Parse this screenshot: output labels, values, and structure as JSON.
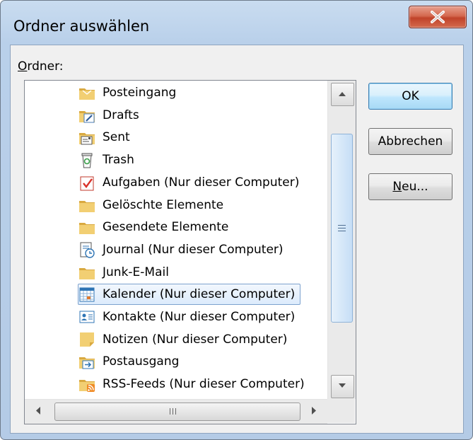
{
  "dialog": {
    "title": "Ordner auswählen",
    "close_label": "X"
  },
  "folder_label": {
    "accel": "O",
    "rest": "rdner:"
  },
  "folders": [
    {
      "label": "Posteingang",
      "icon": "inbox-folder-icon",
      "selected": false
    },
    {
      "label": "Drafts",
      "icon": "drafts-folder-icon",
      "selected": false
    },
    {
      "label": "Sent",
      "icon": "sent-folder-icon",
      "selected": false
    },
    {
      "label": "Trash",
      "icon": "trash-icon",
      "selected": false
    },
    {
      "label": "Aufgaben (Nur dieser Computer)",
      "icon": "tasks-icon",
      "selected": false
    },
    {
      "label": "Gelöschte Elemente",
      "icon": "folder-icon",
      "selected": false
    },
    {
      "label": "Gesendete Elemente",
      "icon": "folder-icon",
      "selected": false
    },
    {
      "label": "Journal (Nur dieser Computer)",
      "icon": "journal-icon",
      "selected": false
    },
    {
      "label": "Junk-E-Mail",
      "icon": "folder-icon",
      "selected": false
    },
    {
      "label": "Kalender (Nur dieser Computer)",
      "icon": "calendar-icon",
      "selected": true
    },
    {
      "label": "Kontakte (Nur dieser Computer)",
      "icon": "contacts-icon",
      "selected": false
    },
    {
      "label": "Notizen (Nur dieser Computer)",
      "icon": "notes-icon",
      "selected": false
    },
    {
      "label": "Postausgang",
      "icon": "outbox-folder-icon",
      "selected": false
    },
    {
      "label": "RSS-Feeds (Nur dieser Computer)",
      "icon": "rss-folder-icon",
      "selected": false
    }
  ],
  "buttons": {
    "ok": "OK",
    "cancel": "Abbrechen",
    "new_accel": "N",
    "new_rest": "eu..."
  },
  "colors": {
    "selection_border": "#7da2ce",
    "close_button": "#c7452c",
    "folder_yellow": "#f2cf73"
  }
}
